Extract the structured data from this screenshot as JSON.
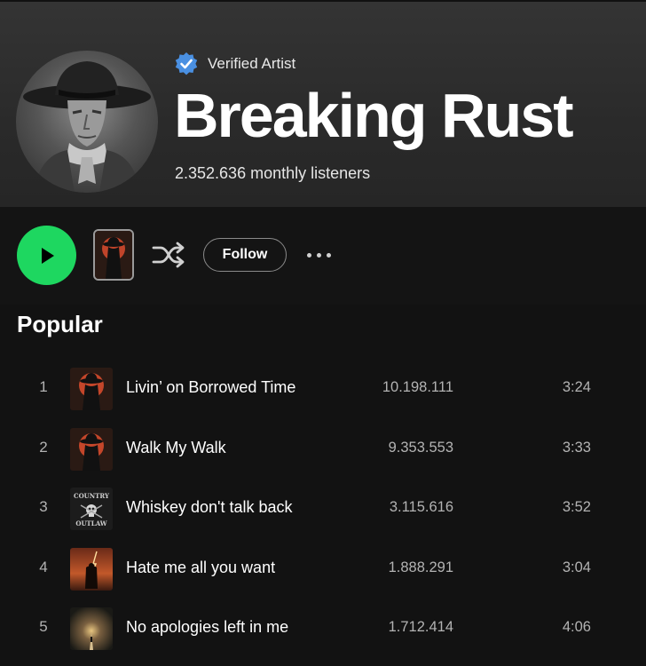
{
  "artist": {
    "verified_label": "Verified Artist",
    "name": "Breaking Rust",
    "monthly_listeners": "2.352.636 monthly listeners"
  },
  "controls": {
    "follow_label": "Follow",
    "play_icon": "play-icon",
    "shuffle_icon": "shuffle-icon",
    "more_icon": "more-options-icon"
  },
  "section": {
    "popular_title": "Popular"
  },
  "tracks": [
    {
      "number": "1",
      "title": "Livin’ on Borrowed Time",
      "plays": "10.198.111",
      "duration": "3:24"
    },
    {
      "number": "2",
      "title": "Walk My Walk",
      "plays": "9.353.553",
      "duration": "3:33"
    },
    {
      "number": "3",
      "title": "Whiskey don't talk back",
      "plays": "3.115.616",
      "duration": "3:52",
      "cover_text_top": "COUNTRY",
      "cover_text_bottom": "OUTLAW"
    },
    {
      "number": "4",
      "title": "Hate me all you want",
      "plays": "1.888.291",
      "duration": "3:04"
    },
    {
      "number": "5",
      "title": "No apologies left in me",
      "plays": "1.712.414",
      "duration": "4:06"
    }
  ],
  "colors": {
    "accent_green": "#1ed760",
    "verified_blue": "#4a90e2",
    "background": "#121212",
    "secondary_text": "#b3b3b3"
  }
}
